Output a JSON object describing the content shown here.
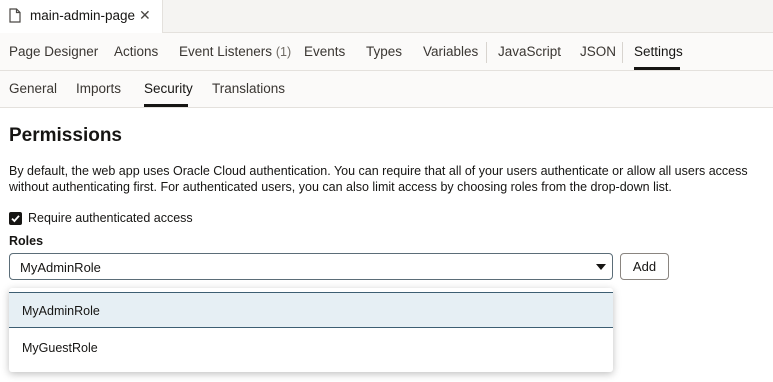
{
  "file_tab": {
    "label": "main-admin-page",
    "close": "✕"
  },
  "main_tabs": [
    {
      "label": "Page Designer"
    },
    {
      "label": "Actions"
    },
    {
      "label": "Event Listeners",
      "count": "(1)"
    },
    {
      "label": "Events"
    },
    {
      "label": "Types"
    },
    {
      "label": "Variables"
    },
    {
      "label": "JavaScript"
    },
    {
      "label": "JSON"
    },
    {
      "label": "Settings",
      "active": true
    }
  ],
  "sub_tabs": [
    {
      "label": "General"
    },
    {
      "label": "Imports"
    },
    {
      "label": "Security",
      "active": true
    },
    {
      "label": "Translations"
    }
  ],
  "content": {
    "heading": "Permissions",
    "description": "By default, the web app uses Oracle Cloud authentication. You can require that all of your users authenticate or allow all users access without authenticating first. For authenticated users, you can also limit access by choosing roles from the drop-down list.",
    "checkbox_label": "Require authenticated access",
    "checkbox_checked": true,
    "roles_label": "Roles",
    "roles_value": "MyAdminRole",
    "add_button": "Add",
    "options": [
      "MyAdminRole",
      "MyGuestRole"
    ]
  },
  "colors": {
    "accent": "#161513",
    "selected_option_bg": "#e6eff4",
    "select_border": "#5b6d78"
  }
}
